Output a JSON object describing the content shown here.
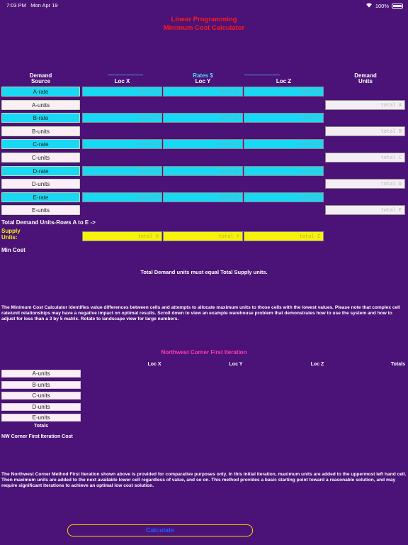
{
  "status_bar": {
    "time": "7:03 PM",
    "date": "Mon Apr 19",
    "battery": "100%"
  },
  "title": {
    "line1": "Linear Programming",
    "line2": "Minimum Cost Calculator"
  },
  "headers": {
    "demand_source_1": "Demand",
    "demand_source_2": "Source",
    "rates": "Rates $",
    "dashes": "-----------------------",
    "loc_x": "Loc X",
    "loc_y": "Loc Y",
    "loc_z": "Loc Z",
    "demand_units_1": "Demand",
    "demand_units_2": "Units"
  },
  "rows": [
    {
      "label": "A-rate",
      "kind": "rate",
      "ph": [
        "rate_Ax",
        "rate_Ay",
        "rate_Az"
      ]
    },
    {
      "label": "A-units",
      "kind": "units",
      "total": "total A"
    },
    {
      "label": "B-rate",
      "kind": "rate",
      "ph": [
        "rate_Bx",
        "rate_By",
        "rate_Bz"
      ]
    },
    {
      "label": "B-units",
      "kind": "units",
      "total": "total B"
    },
    {
      "label": "C-rate",
      "kind": "rate",
      "ph": [
        "rate_Cx",
        "rate_Cy",
        "rate_Cz"
      ]
    },
    {
      "label": "C-units",
      "kind": "units",
      "total": "total C"
    },
    {
      "label": "D-rate",
      "kind": "rate",
      "ph": [
        "rate_Dx",
        "rate_Dy",
        "rate_Dz"
      ]
    },
    {
      "label": "D-units",
      "kind": "units",
      "total": "total D"
    },
    {
      "label": "E-rate",
      "kind": "rate",
      "ph": [
        "rate_Ex",
        "rate_Ey",
        "rate_Ez"
      ]
    },
    {
      "label": "E-units",
      "kind": "units",
      "total": "total E"
    }
  ],
  "total_demand_label": "Total Demand Units-Rows A to E ->",
  "supply": {
    "label1": "Supply",
    "label2": "Units:",
    "ph": [
      "total X",
      "total Y",
      "total Z"
    ]
  },
  "min_cost_label": "Min Cost",
  "notice": "Total Demand units must equal Total Supply units.",
  "description": "The Minimum Cost Calculator identifies value differences between cells and attempts to allocate maximum units to those cells with the lowest values.  Please note that complex cell rate/unit relationships may have a negative impact on optimal results. Scroll down to view an example warehouse problem that demonstrates how to use the system and how to adjust for less than a 3 by 5 matrix. Rotate to landscape view for large numbers.",
  "nw": {
    "title": "Northwest Corner First Iteration",
    "loc_x": "Loc X",
    "loc_y": "Loc Y",
    "loc_z": "Loc Z",
    "totals": "Totals",
    "rows": [
      "A-units",
      "B-units",
      "C-units",
      "D-units",
      "E-units"
    ],
    "totals_row": "Totals",
    "cost_label": "NW Corner First Iteration Cost"
  },
  "nw_description": "The Northwest Corner Method First Iteration shown above is provided for comparative purposes only.  In this initial iteration, maximum units are added to the uppermost left hand cell. Then maximum units are added to the next available lower cell regardless of value, and so on.  This method provides a basic starting point toward a reasonable solution, and may require significant iterations to achieve an optimal low cost solution.",
  "calculate_button": "Calculate",
  "colors": {
    "background": "#4b1277",
    "title": "#ff1a1a",
    "rate_cell": "#19d8f4",
    "supply_cell": "#f6f20c",
    "accent": "#4fd9ff",
    "nw_title": "#ff3cb4"
  }
}
